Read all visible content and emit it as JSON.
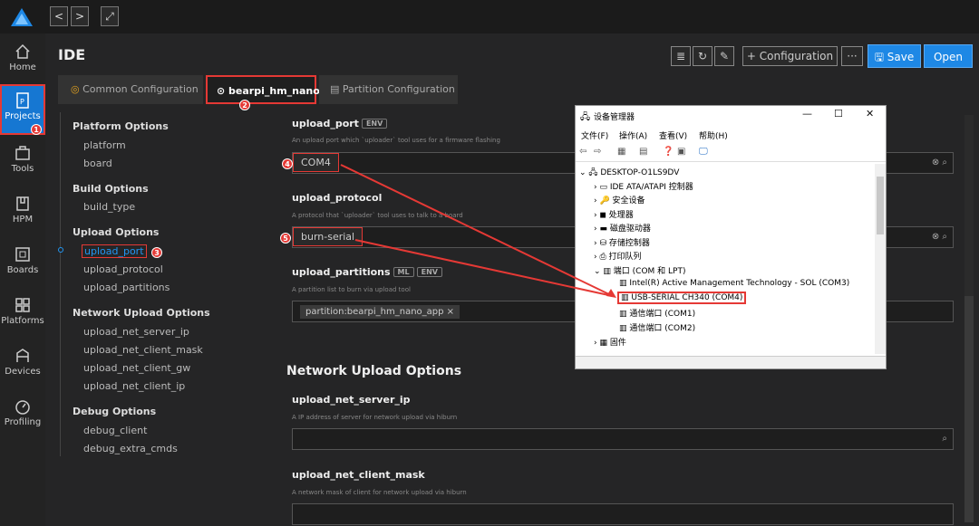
{
  "titlebar": {
    "back": "<",
    "forward": ">",
    "expand": "⤢"
  },
  "sidebar": {
    "items": [
      {
        "label": "Home"
      },
      {
        "label": "Projects"
      },
      {
        "label": "Tools"
      },
      {
        "label": "HPM"
      },
      {
        "label": "Boards"
      },
      {
        "label": "Platforms"
      },
      {
        "label": "Devices"
      },
      {
        "label": "Profiling"
      }
    ]
  },
  "header": {
    "title": "IDE",
    "configuration": "+ Configuration",
    "more": "···",
    "save": "Save",
    "open": "Open"
  },
  "tabs": [
    {
      "label": "Common Configuration"
    },
    {
      "label": "bearpi_hm_nano"
    },
    {
      "label": "Partition Configuration"
    }
  ],
  "leftnav": {
    "platform_options": "Platform Options",
    "platform": "platform",
    "board": "board",
    "build_options": "Build Options",
    "build_type": "build_type",
    "upload_options": "Upload Options",
    "upload_port": "upload_port",
    "upload_protocol": "upload_protocol",
    "upload_partitions": "upload_partitions",
    "network_upload_options": "Network Upload Options",
    "upload_net_server_ip": "upload_net_server_ip",
    "upload_net_client_mask": "upload_net_client_mask",
    "upload_net_client_gw": "upload_net_client_gw",
    "upload_net_client_ip": "upload_net_client_ip",
    "debug_options": "Debug Options",
    "debug_client": "debug_client",
    "debug_extra_cmds": "debug_extra_cmds"
  },
  "form": {
    "upload_port": {
      "label": "upload_port",
      "tag": "ENV",
      "desc": "An upload port which `uploader` tool uses for a firmware flashing",
      "value": "COM4"
    },
    "upload_protocol": {
      "label": "upload_protocol",
      "desc": "A protocol that `uploader` tool uses to talk to a board",
      "value": "burn-serial"
    },
    "upload_partitions": {
      "label": "upload_partitions",
      "tag1": "ML",
      "tag2": "ENV",
      "desc": "A partition list to burn via upload tool",
      "chip": "partition:bearpi_hm_nano_app ×"
    },
    "network_heading": "Network Upload Options",
    "upload_net_server_ip": {
      "label": "upload_net_server_ip",
      "desc": "A IP address of server for network upload via hiburn"
    },
    "upload_net_client_mask": {
      "label": "upload_net_client_mask",
      "desc": "A network mask of client for network upload via hiburn"
    }
  },
  "badges": [
    "1",
    "2",
    "3",
    "4",
    "5"
  ],
  "device_manager": {
    "title": "设备管理器",
    "menu": [
      "文件(F)",
      "操作(A)",
      "查看(V)",
      "帮助(H)"
    ],
    "tree": [
      "DESKTOP-O1LS9DV",
      "IDE ATA/ATAPI 控制器",
      "安全设备",
      "处理器",
      "磁盘驱动器",
      "存储控制器",
      "打印队列",
      "端口 (COM 和 LPT)",
      "Intel(R) Active Management Technology - SOL (COM3)",
      "USB-SERIAL CH340 (COM4)",
      "通信端口 (COM1)",
      "通信端口 (COM2)",
      "固件"
    ]
  }
}
